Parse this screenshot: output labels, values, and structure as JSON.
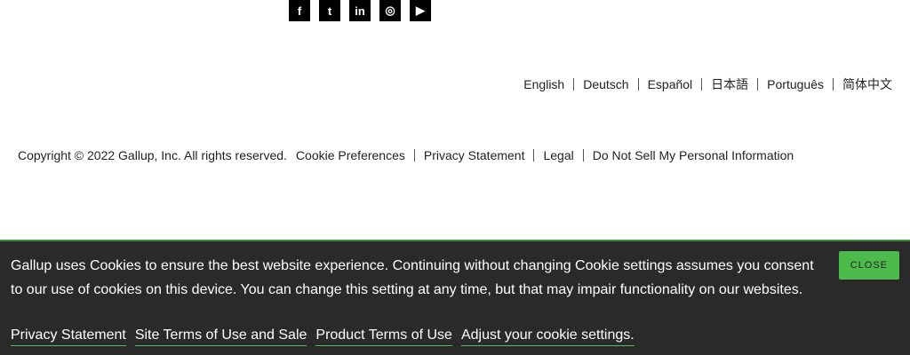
{
  "social": [
    {
      "icon": "facebook-icon",
      "glyph": "f"
    },
    {
      "icon": "twitter-icon",
      "glyph": "t"
    },
    {
      "icon": "linkedin-icon",
      "glyph": "in"
    },
    {
      "icon": "instagram-icon",
      "glyph": "◎"
    },
    {
      "icon": "youtube-icon",
      "glyph": "▶"
    }
  ],
  "languages": [
    "English",
    "Deutsch",
    "Español",
    "日本語",
    "Português",
    "简体中文"
  ],
  "footer": {
    "copyright": "Copyright © 2022 Gallup, Inc. All rights reserved.",
    "links": [
      "Cookie Preferences",
      "Privacy Statement",
      "Legal",
      "Do Not Sell My Personal Information"
    ]
  },
  "cookie_banner": {
    "message": "Gallup uses Cookies to ensure the best website experience. Continuing without changing Cookie settings assumes you consent to our use of cookies on this device. You can change this setting at any time, but that may impair functionality on our websites.",
    "links": [
      "Privacy Statement",
      "Site Terms of Use and Sale",
      "Product Terms of Use",
      "Adjust your cookie settings."
    ],
    "close_label": "CLOSE",
    "accent_color": "#4cbb4c",
    "background_color": "#2a2a2a"
  }
}
